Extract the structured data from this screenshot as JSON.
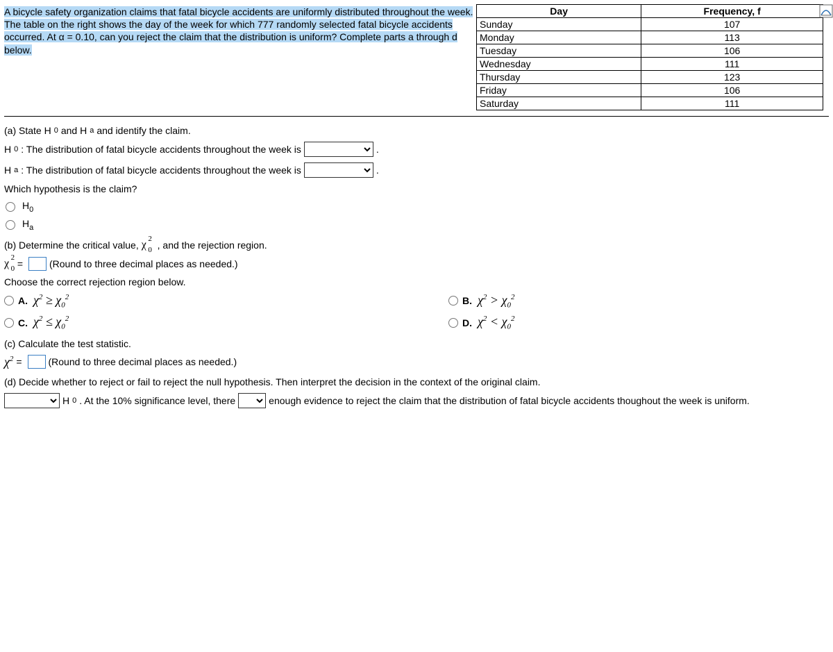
{
  "prompt": {
    "highlighted": "A bicycle safety organization claims that fatal bicycle accidents are uniformly distributed throughout the week. The table on the right shows the day of the week for which 777 randomly selected fatal bicycle accidents occurred. At α = 0.10, can you reject the claim that the distribution is uniform? Complete parts a through d below."
  },
  "table": {
    "headers": [
      "Day",
      "Frequency, f"
    ],
    "rows": [
      {
        "day": "Sunday",
        "f": "107"
      },
      {
        "day": "Monday",
        "f": "113"
      },
      {
        "day": "Tuesday",
        "f": "106"
      },
      {
        "day": "Wednesday",
        "f": "111"
      },
      {
        "day": "Thursday",
        "f": "123"
      },
      {
        "day": "Friday",
        "f": "106"
      },
      {
        "day": "Saturday",
        "f": "111"
      }
    ]
  },
  "a": {
    "heading": "(a) State H",
    "heading2": " and H",
    "heading3": " and identify the claim.",
    "h0_pre": "H",
    "h0_text": ": The distribution of fatal bicycle accidents throughout the week is",
    "ha_pre": "H",
    "ha_text": ": The distribution of fatal bicycle accidents throughout the week is",
    "which": "Which hypothesis is the claim?",
    "opt1": "H",
    "opt2": "H"
  },
  "b": {
    "heading_pre": "(b) Determine the critical value, ",
    "heading_post": ", and the rejection region.",
    "eq_post": " (Round to three decimal places as needed.)",
    "choose": "Choose the correct rejection region below.",
    "labels": {
      "A": "A.",
      "B": "B.",
      "C": "C.",
      "D": "D."
    }
  },
  "c": {
    "heading": "(c) Calculate the test statistic.",
    "round": " (Round to three decimal places as needed.)"
  },
  "d": {
    "heading": "(d) Decide whether to reject or fail to reject the null hypothesis. Then interpret the decision in the context of the original claim.",
    "mid1": " H",
    "mid2": ". At the 10% significance level, there ",
    "mid3": " enough evidence to reject the claim that the distribution of fatal bicycle accidents thoughout the week is uniform."
  },
  "period": "."
}
